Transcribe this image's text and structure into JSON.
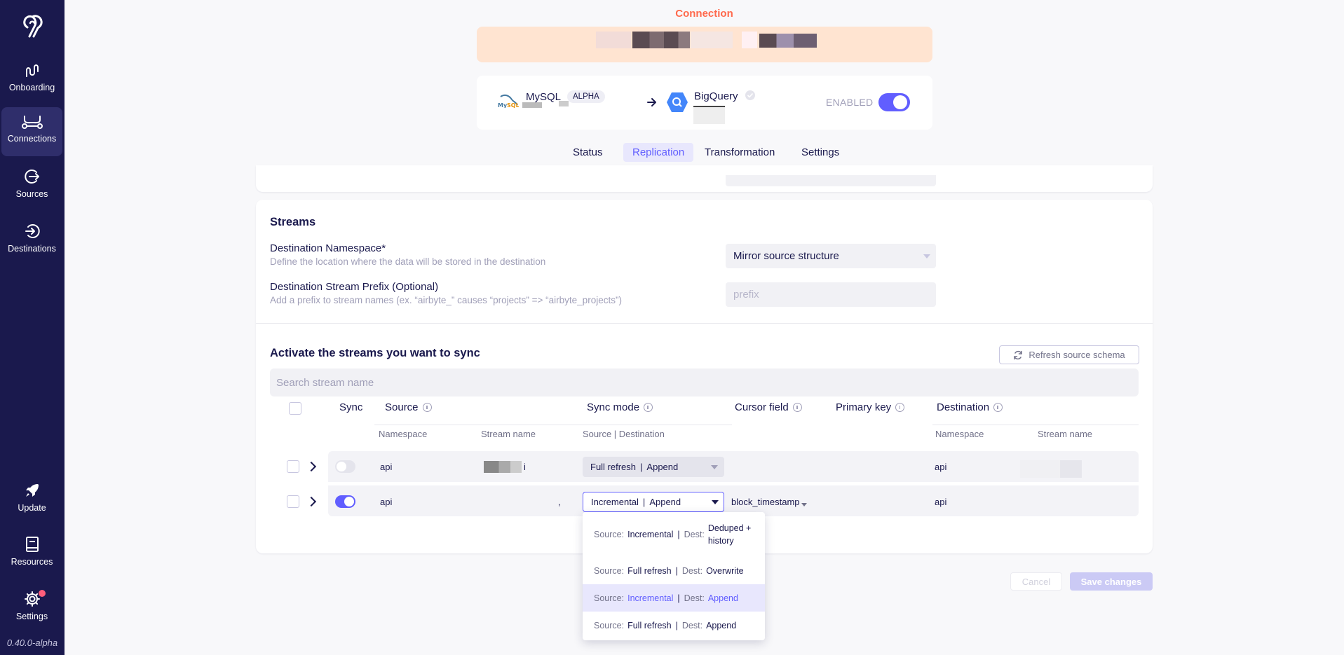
{
  "sidebar": {
    "items": [
      {
        "label": "Onboarding",
        "icon": "onboarding-icon"
      },
      {
        "label": "Connections",
        "icon": "connections-icon",
        "active": true
      },
      {
        "label": "Sources",
        "icon": "sources-icon"
      },
      {
        "label": "Destinations",
        "icon": "destinations-icon"
      }
    ],
    "bottom_items": [
      {
        "label": "Update",
        "icon": "rocket-icon"
      },
      {
        "label": "Resources",
        "icon": "book-icon"
      },
      {
        "label": "Settings",
        "icon": "gear-icon"
      }
    ],
    "version": "0.40.0-alpha"
  },
  "header": {
    "title": "Connection"
  },
  "connection": {
    "source_name": "MySQL",
    "source_badge": "ALPHA",
    "destination_name": "BigQuery",
    "enabled_label": "ENABLED",
    "enabled": true
  },
  "tabs": [
    {
      "label": "Status"
    },
    {
      "label": "Replication",
      "active": true
    },
    {
      "label": "Transformation"
    },
    {
      "label": "Settings"
    }
  ],
  "streams_section": {
    "title": "Streams",
    "namespace_label": "Destination Namespace*",
    "namespace_desc": "Define the location where the data will be stored in the destination",
    "namespace_value": "Mirror source structure",
    "prefix_label": "Destination Stream Prefix (Optional)",
    "prefix_desc": "Add a prefix to stream names (ex. “airbyte_” causes “projects” => “airbyte_projects”)",
    "prefix_placeholder": "prefix"
  },
  "activate": {
    "title": "Activate the streams you want to sync",
    "refresh_label": "Refresh source schema",
    "search_placeholder": "Search stream name",
    "columns": {
      "sync": "Sync",
      "source": "Source",
      "sync_mode": "Sync mode",
      "cursor": "Cursor field",
      "primary_key": "Primary key",
      "destination": "Destination"
    },
    "subcolumns": {
      "namespace": "Namespace",
      "stream_name": "Stream name",
      "source_dest": "Source | Destination",
      "dest_namespace": "Namespace",
      "dest_stream_name": "Stream name"
    },
    "rows": [
      {
        "namespace": "api",
        "stream_suffix": "i",
        "sync_source": "Full refresh",
        "sync_dest": "Append",
        "cursor": "",
        "dest_namespace": "api",
        "enabled": false
      },
      {
        "namespace": "api",
        "stream_suffix": ",",
        "sync_source": "Incremental",
        "sync_dest": "Append",
        "cursor": "block_timestamp",
        "dest_namespace": "api",
        "enabled": true
      }
    ]
  },
  "dropdown": {
    "source_prefix": "Source:",
    "dest_prefix": "Dest:",
    "options": [
      {
        "source": "Incremental",
        "dest": "Deduped + history"
      },
      {
        "source": "Full refresh",
        "dest": "Overwrite"
      },
      {
        "source": "Incremental",
        "dest": "Append",
        "selected": true
      },
      {
        "source": "Full refresh",
        "dest": "Append"
      }
    ]
  },
  "footer": {
    "cancel": "Cancel",
    "save": "Save changes"
  },
  "colors": {
    "sidebar": "#1a194d",
    "accent": "#615eff",
    "connection_title": "#ff6a4d",
    "name_bar": "#ffe4d1",
    "notification_dot": "#ff5e7b"
  }
}
